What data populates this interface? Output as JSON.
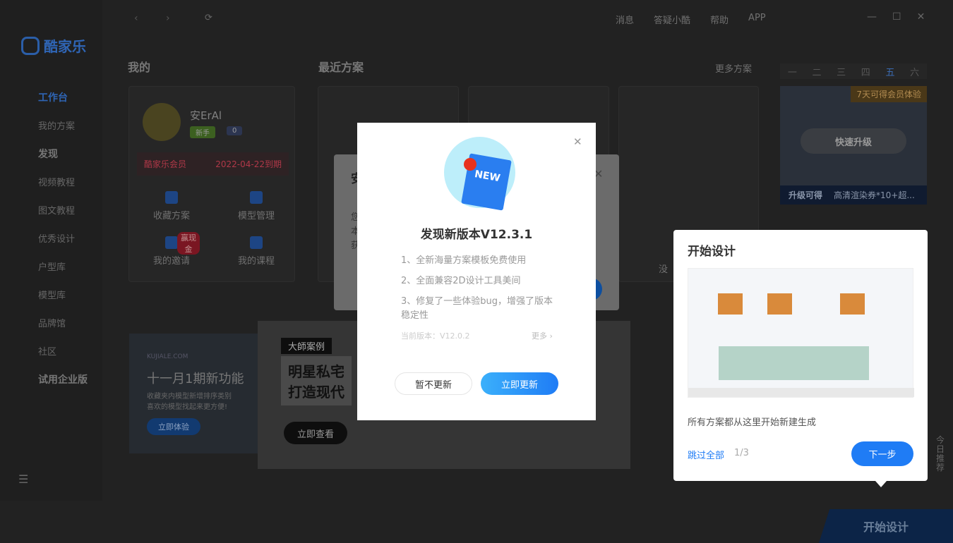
{
  "app": {
    "logo": "酷家乐"
  },
  "topbar": {
    "messages": "消息",
    "support": "答疑小酷",
    "help": "帮助",
    "app": "APP"
  },
  "sidebar": {
    "items": [
      {
        "label": "工作台",
        "type": "header",
        "active": true
      },
      {
        "label": "我的方案"
      },
      {
        "label": "发现",
        "type": "header"
      },
      {
        "label": "视频教程"
      },
      {
        "label": "图文教程"
      },
      {
        "label": "优秀设计"
      },
      {
        "label": "户型库"
      },
      {
        "label": "模型库"
      },
      {
        "label": "品牌馆"
      },
      {
        "label": "社区"
      },
      {
        "label": "试用企业版",
        "type": "header"
      }
    ]
  },
  "mine": {
    "title": "我的",
    "username": "安ErAl",
    "badge_level": "新手",
    "badge_count": "0",
    "member_label": "酷家乐会员",
    "member_expiry": "2022-04-22到期",
    "actions": [
      {
        "label": "收藏方案",
        "icon": "star-icon"
      },
      {
        "label": "模型管理",
        "icon": "layout-icon"
      },
      {
        "label": "我的邀请",
        "icon": "invite-icon",
        "tag": "赢现金"
      },
      {
        "label": "我的课程",
        "icon": "play-icon"
      }
    ]
  },
  "recent": {
    "title": "最近方案",
    "more": "更多方案",
    "empty_text": "没"
  },
  "weekdays": [
    "一",
    "二",
    "三",
    "四",
    "五",
    "六"
  ],
  "promo": {
    "ribbon": "7天可得会员体验",
    "button": "快速升级",
    "footer_label": "升级可得",
    "footer_text": "高清渲染券*10+超..."
  },
  "banners": [
    {
      "site": "KUJIALE.COM",
      "title": "十一月1期新功能",
      "line1": "收藏夹内模型新增排序类别",
      "line2": "喜欢的模型找起来更方便!",
      "button": "立即体验"
    },
    {
      "tag": "大師案例",
      "title1": "明星私宅",
      "title2": "打造现代",
      "button": "立即查看"
    }
  ],
  "background_dialog": {
    "title": "安",
    "lines": [
      "您",
      "本",
      "获"
    ]
  },
  "update_dialog": {
    "title": "发现新版本V12.3.1",
    "badge": "NEW",
    "notes": [
      "1、全新海量方案模板免费使用",
      "2、全面兼容2D设计工具美间",
      "3、修复了一些体验bug，增强了版本稳定性"
    ],
    "current_version": "当前版本：V12.0.2",
    "more": "更多",
    "later": "暂不更新",
    "update_now": "立即更新"
  },
  "tour": {
    "title": "开始设计",
    "description": "所有方案都从这里开始新建生成",
    "skip": "跳过全部",
    "step": "1/3",
    "next": "下一步"
  },
  "start_design": "开始设计",
  "today_recommend": "今日推荐",
  "colors": {
    "primary": "#1f7cf5",
    "member_red": "#e0253b"
  }
}
